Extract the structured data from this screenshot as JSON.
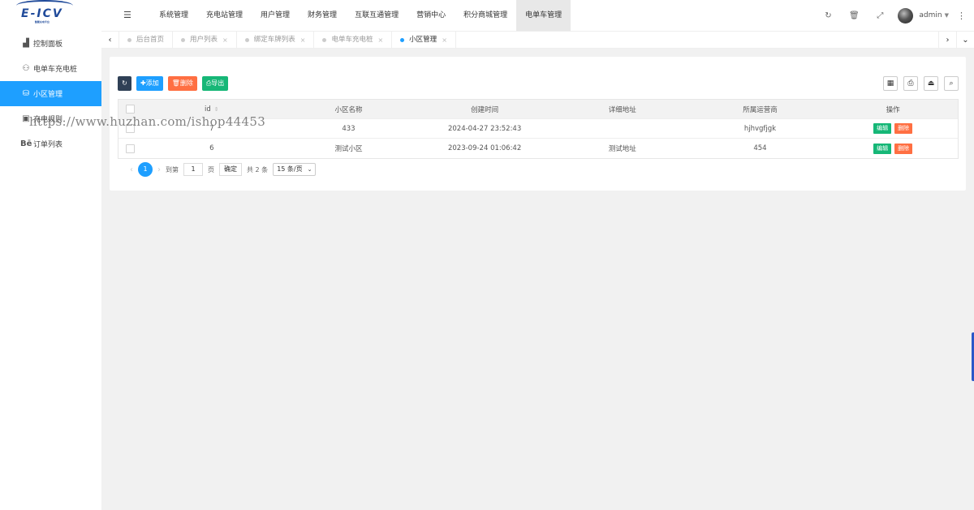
{
  "logo": {
    "text": "E-ICV",
    "subtext": "智能充电平台"
  },
  "sidebar": {
    "items": [
      {
        "icon": "area-chart-icon",
        "glyph": "▟",
        "label": "控制面板"
      },
      {
        "icon": "motorcycle-icon",
        "glyph": "⚇",
        "label": "电单车充电桩"
      },
      {
        "icon": "database-icon",
        "glyph": "⛁",
        "label": "小区管理",
        "active": true
      },
      {
        "icon": "money-icon",
        "glyph": "▣",
        "label": "充电规则"
      },
      {
        "icon": "behance-icon",
        "glyph": "Bē",
        "label": "订单列表"
      }
    ]
  },
  "header": {
    "fold_glyph": "☰",
    "nav": [
      {
        "label": "系统管理"
      },
      {
        "label": "充电站管理"
      },
      {
        "label": "用户管理"
      },
      {
        "label": "财务管理"
      },
      {
        "label": "互联互通管理"
      },
      {
        "label": "营销中心"
      },
      {
        "label": "积分商城管理"
      },
      {
        "label": "电单车管理",
        "active": true
      }
    ],
    "icons": [
      {
        "name": "refresh-icon",
        "glyph": "↻"
      },
      {
        "name": "trash-icon",
        "glyph": "🗑"
      },
      {
        "name": "fullscreen-icon",
        "glyph": "⤢"
      }
    ],
    "user": "admin",
    "caret": "▼",
    "more_glyph": "⋮"
  },
  "tabs": {
    "left_arrow": "‹",
    "right_arrow": "›",
    "down_arrow": "⌄",
    "items": [
      {
        "label": "后台首页",
        "closable": false
      },
      {
        "label": "用户列表",
        "closable": true
      },
      {
        "label": "绑定车牌列表",
        "closable": true
      },
      {
        "label": "电单车充电桩",
        "closable": true
      },
      {
        "label": "小区管理",
        "closable": true,
        "active": true
      }
    ],
    "close_glyph": "×"
  },
  "toolbar": {
    "refresh_glyph": "↻",
    "add_label": "✚添加",
    "delete_label": "🗑删除",
    "export_label": "⎙导出",
    "right_icons": [
      {
        "name": "columns-icon",
        "glyph": "▦"
      },
      {
        "name": "print-icon",
        "glyph": "⎙"
      },
      {
        "name": "export-icon",
        "glyph": "⏏"
      },
      {
        "name": "search-icon",
        "glyph": "⌕"
      }
    ]
  },
  "table": {
    "headers": {
      "id": "id",
      "sort_glyph": "⇕",
      "name": "小区名称",
      "created": "创建时间",
      "address": "详细地址",
      "operator": "所属运营商",
      "actions": "操作"
    },
    "rows": [
      {
        "id": "7",
        "name": "433",
        "created": "2024-04-27 23:52:43",
        "address": "",
        "operator": "hjhvgfjgk"
      },
      {
        "id": "6",
        "name": "测试小区",
        "created": "2023-09-24 01:06:42",
        "address": "测试地址",
        "operator": "454"
      }
    ],
    "edit_label": "编辑",
    "delete_label": "删除"
  },
  "pager": {
    "prev": "‹",
    "current": "1",
    "next": "›",
    "goto_label": "到第",
    "goto_value": "1",
    "page_label": "页",
    "confirm_label": "确定",
    "total_label": "共 2 条",
    "per_page": "15 条/页",
    "select_caret": "⌄"
  },
  "watermark": "https://www.huzhan.com/ishop44453"
}
